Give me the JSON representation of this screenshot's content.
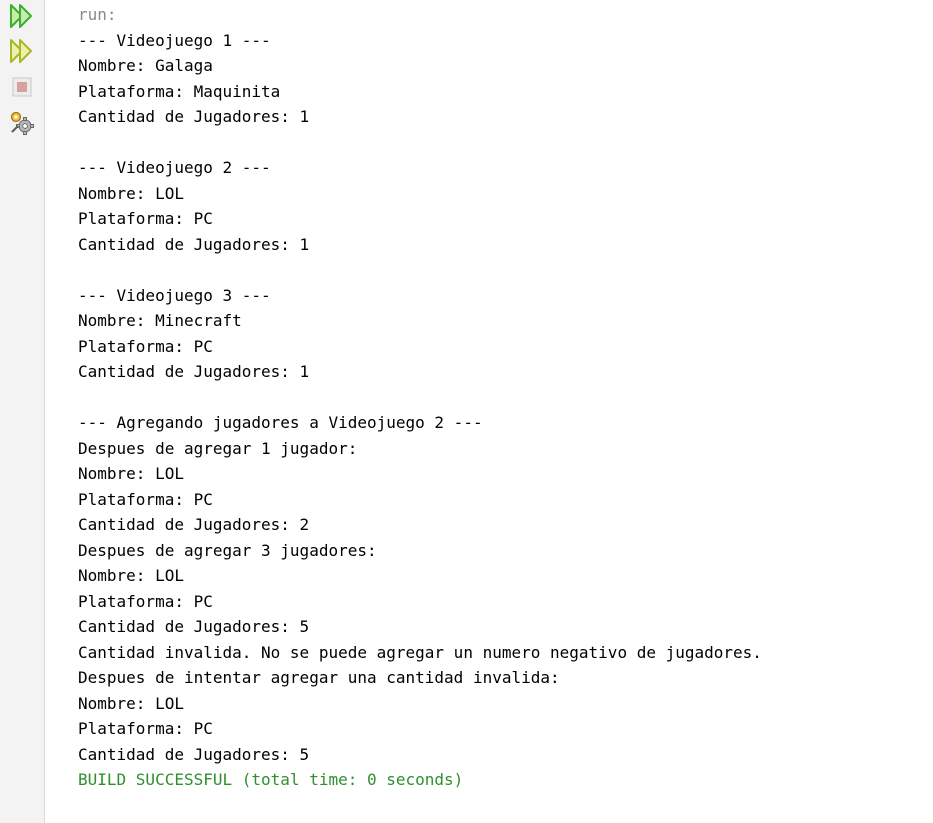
{
  "colors": {
    "run_arrow": "#3fae2a",
    "rerun_arrow": "#a8b82a",
    "stop_disabled": "#d9a0a0",
    "prompt_text": "#8a8a8a",
    "normal_text": "#000000",
    "success_text": "#2f8f2f"
  },
  "toolbar": {
    "buttons": [
      {
        "name": "run-button",
        "icon": "double-play-icon"
      },
      {
        "name": "rerun-button",
        "icon": "double-play-icon"
      },
      {
        "name": "stop-button",
        "icon": "stop-icon"
      },
      {
        "name": "settings-button",
        "icon": "gear-icon"
      }
    ]
  },
  "console": {
    "lines": [
      {
        "text": "run:",
        "kind": "run"
      },
      {
        "text": "--- Videojuego 1 ---",
        "kind": "normal"
      },
      {
        "text": "Nombre: Galaga",
        "kind": "normal"
      },
      {
        "text": "Plataforma: Maquinita",
        "kind": "normal"
      },
      {
        "text": "Cantidad de Jugadores: 1",
        "kind": "normal"
      },
      {
        "text": "",
        "kind": "normal"
      },
      {
        "text": "--- Videojuego 2 ---",
        "kind": "normal"
      },
      {
        "text": "Nombre: LOL",
        "kind": "normal"
      },
      {
        "text": "Plataforma: PC",
        "kind": "normal"
      },
      {
        "text": "Cantidad de Jugadores: 1",
        "kind": "normal"
      },
      {
        "text": "",
        "kind": "normal"
      },
      {
        "text": "--- Videojuego 3 ---",
        "kind": "normal"
      },
      {
        "text": "Nombre: Minecraft",
        "kind": "normal"
      },
      {
        "text": "Plataforma: PC",
        "kind": "normal"
      },
      {
        "text": "Cantidad de Jugadores: 1",
        "kind": "normal"
      },
      {
        "text": "",
        "kind": "normal"
      },
      {
        "text": "--- Agregando jugadores a Videojuego 2 ---",
        "kind": "normal"
      },
      {
        "text": "Despues de agregar 1 jugador:",
        "kind": "normal"
      },
      {
        "text": "Nombre: LOL",
        "kind": "normal"
      },
      {
        "text": "Plataforma: PC",
        "kind": "normal"
      },
      {
        "text": "Cantidad de Jugadores: 2",
        "kind": "normal"
      },
      {
        "text": "Despues de agregar 3 jugadores:",
        "kind": "normal"
      },
      {
        "text": "Nombre: LOL",
        "kind": "normal"
      },
      {
        "text": "Plataforma: PC",
        "kind": "normal"
      },
      {
        "text": "Cantidad de Jugadores: 5",
        "kind": "normal"
      },
      {
        "text": "Cantidad invalida. No se puede agregar un numero negativo de jugadores.",
        "kind": "normal"
      },
      {
        "text": "Despues de intentar agregar una cantidad invalida:",
        "kind": "normal"
      },
      {
        "text": "Nombre: LOL",
        "kind": "normal"
      },
      {
        "text": "Plataforma: PC",
        "kind": "normal"
      },
      {
        "text": "Cantidad de Jugadores: 5",
        "kind": "normal"
      },
      {
        "text": "BUILD SUCCESSFUL (total time: 0 seconds)",
        "kind": "success"
      }
    ]
  }
}
